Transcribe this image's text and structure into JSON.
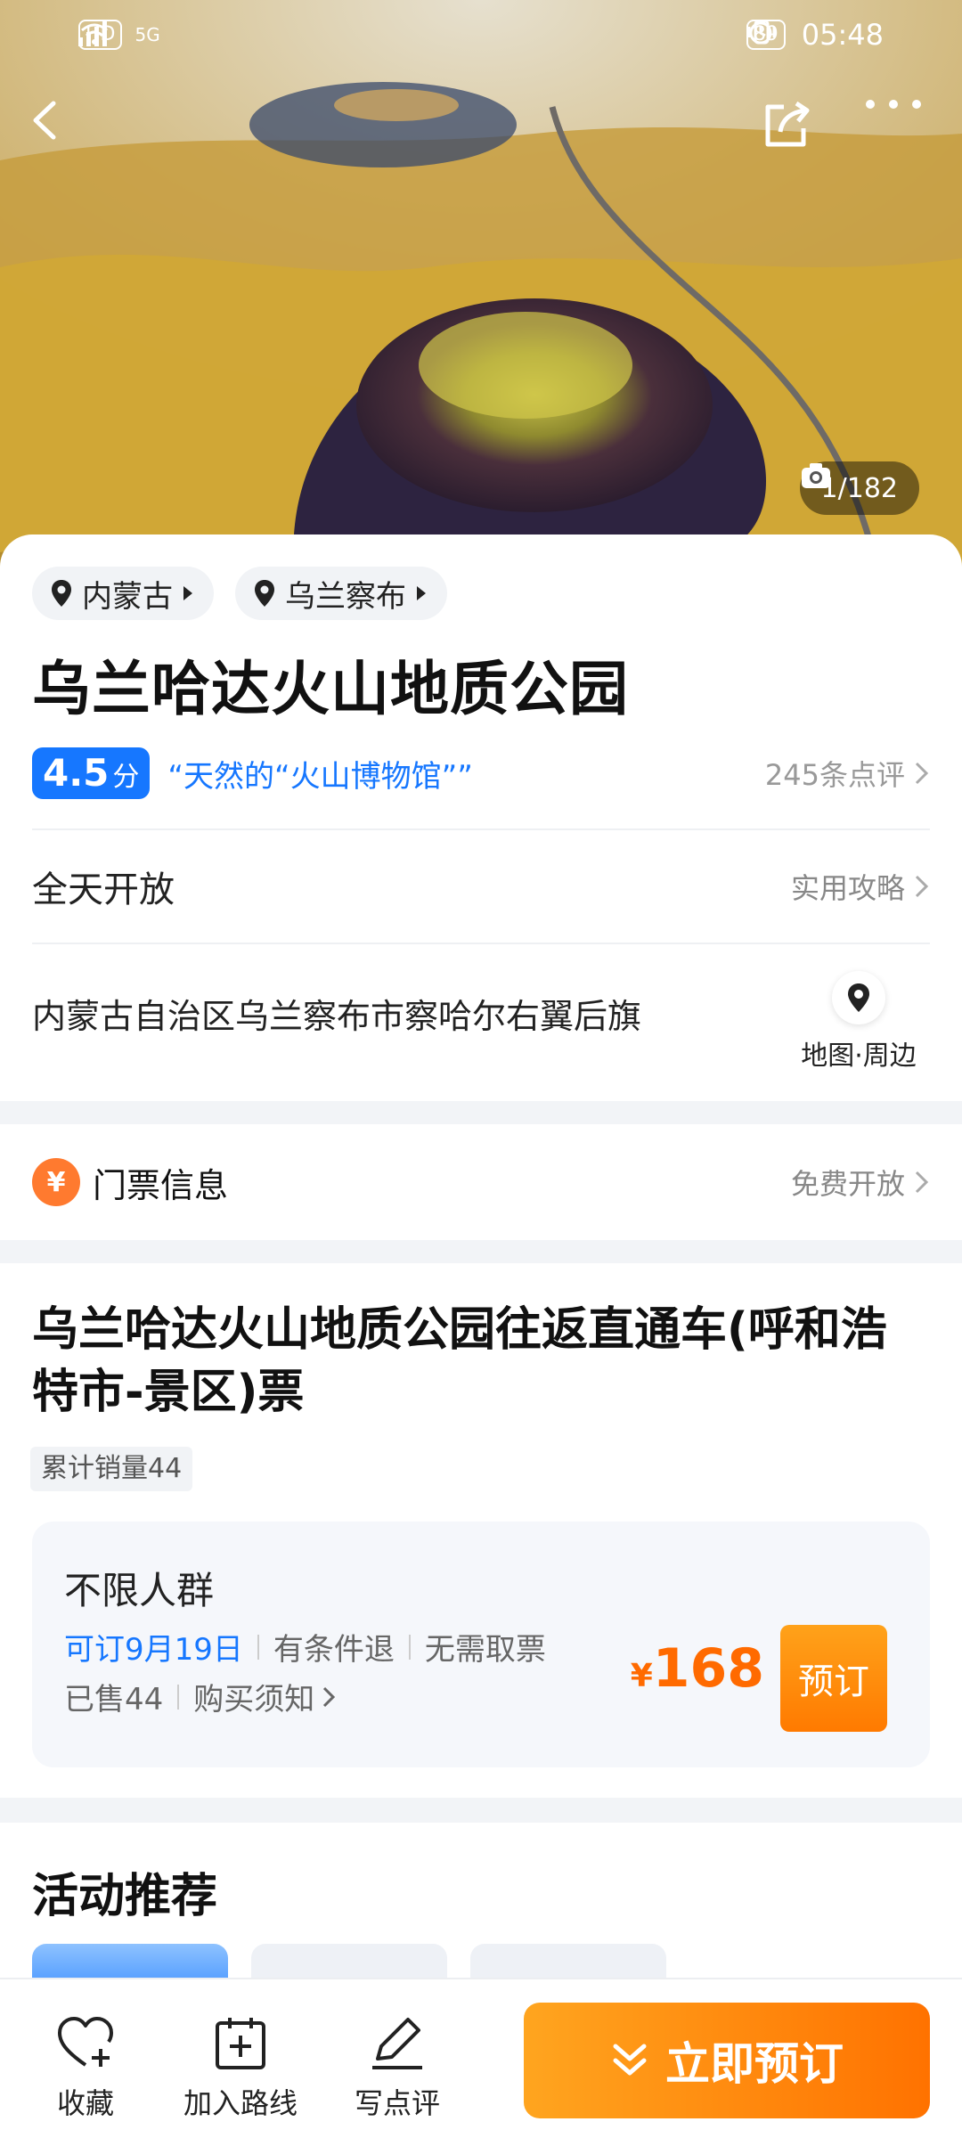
{
  "status_bar": {
    "left_chips": [
      "HD",
      "5G"
    ],
    "battery": "89",
    "time": "05:48"
  },
  "hero": {
    "photo_counter": "1/182"
  },
  "location_chips": [
    "内蒙古",
    "乌兰察布"
  ],
  "title": "乌兰哈达火山地质公园",
  "rating": {
    "score": "4.5",
    "unit": "分",
    "slogan": "“天然的“火山博物馆””",
    "reviews": "245条点评"
  },
  "hours": {
    "label": "全天开放",
    "link": "实用攻略"
  },
  "address": {
    "text": "内蒙古自治区乌兰察布市察哈尔右翼后旗",
    "map_label": "地图·周边"
  },
  "ticket_info": {
    "icon_text": "¥",
    "label": "门票信息",
    "value": "免费开放"
  },
  "product": {
    "title": "乌兰哈达火山地质公园往返直通车(呼和浩特市-景区)票",
    "sales_tag": "累计销量44",
    "offer": {
      "name": "不限人群",
      "bookable": "可订9月19日",
      "refund": "有条件退",
      "pickup": "无需取票",
      "sold": "已售44",
      "notice": "购买须知",
      "currency": "¥",
      "price": "168",
      "book_label": "预订"
    }
  },
  "activities": {
    "title": "活动推荐"
  },
  "bottom_bar": {
    "favorite": "收藏",
    "add_route": "加入路线",
    "write_review": "写点评",
    "cta": "立即预订"
  },
  "colors": {
    "accent_blue": "#1677ff",
    "accent_orange": "#ff7a00"
  }
}
